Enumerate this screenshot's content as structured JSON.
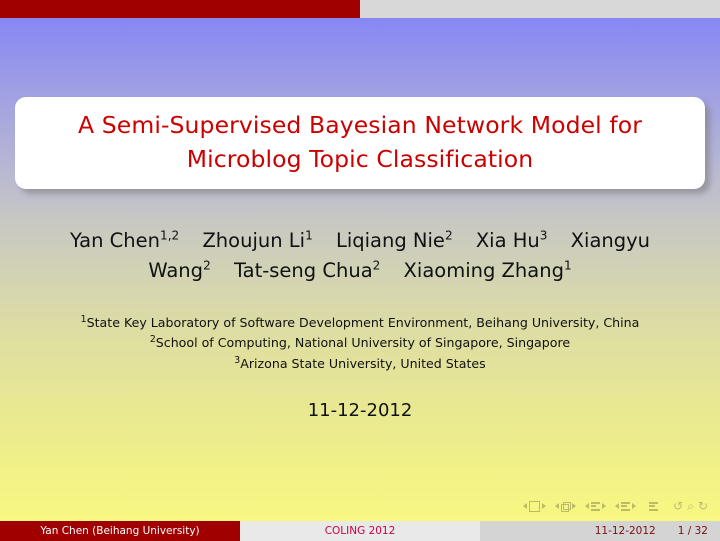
{
  "slide": {
    "title_line1": "A Semi-Supervised Bayesian Network Model for",
    "title_line2": "Microblog Topic Classification",
    "date": "11-12-2012",
    "title_color": "#cc0000",
    "bar_color": "#a00000"
  },
  "authors": [
    {
      "name": "Yan Chen",
      "sup": "1,2"
    },
    {
      "name": "Zhoujun Li",
      "sup": "1"
    },
    {
      "name": "Liqiang Nie",
      "sup": "2"
    },
    {
      "name": "Xia Hu",
      "sup": "3"
    },
    {
      "name": "Xiangyu Wang",
      "sup": "2"
    },
    {
      "name": "Tat-seng Chua",
      "sup": "2"
    },
    {
      "name": "Xiaoming Zhang",
      "sup": "1"
    }
  ],
  "authors_line1_part": "Xiangyu",
  "authors_line2_start": "Wang",
  "affiliations": [
    {
      "sup": "1",
      "text": "State Key Laboratory of Software Development Environment, Beihang University, China"
    },
    {
      "sup": "2",
      "text": "School of Computing, National University of Singapore, Singapore"
    },
    {
      "sup": "3",
      "text": "Arizona State University, United States"
    }
  ],
  "footer": {
    "author": "Yan Chen  (Beihang University)",
    "conference": "COLING 2012",
    "date": "11-12-2012",
    "page": "1 / 32"
  },
  "nav": {
    "slide_icon": "slide-nav-icon",
    "frame_icon": "frame-nav-icon",
    "subsection_icon": "subsection-nav-icon",
    "section_icon": "section-nav-icon",
    "doc_icon": "document-nav-icon",
    "back_icon": "↺",
    "search_icon": "⌕",
    "forward_icon": "↻"
  }
}
